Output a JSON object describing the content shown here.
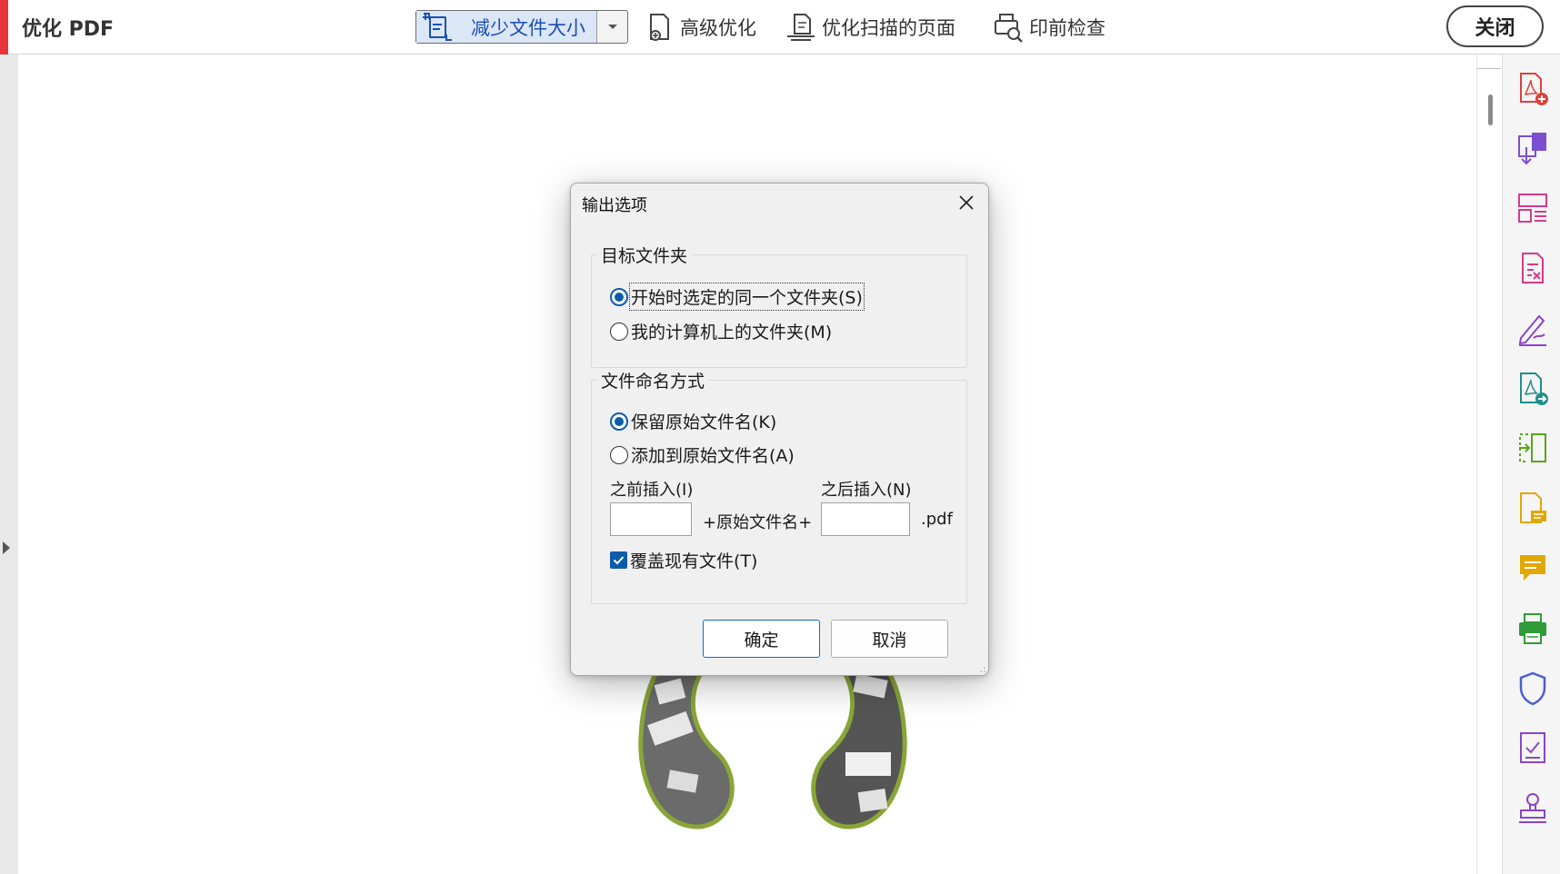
{
  "toolbar": {
    "title": "优化 PDF",
    "dropdown_label": "减少文件大小",
    "tools": [
      "高级优化",
      "优化扫描的页面",
      "印前检查"
    ],
    "close_label": "关闭"
  },
  "dialog": {
    "title": "输出选项",
    "target_folder": {
      "legend": "目标文件夹",
      "option_same": "开始时选定的同一个文件夹(S)",
      "option_computer": "我的计算机上的文件夹(M)"
    },
    "naming": {
      "legend": "文件命名方式",
      "option_keep": "保留原始文件名(K)",
      "option_add": "添加到原始文件名(A)",
      "before_label": "之前插入(I)",
      "after_label": "之后插入(N)",
      "middle_text": "+原始文件名+",
      "extension": ".pdf",
      "before_value": "",
      "after_value": "",
      "overwrite_label": "覆盖现有文件(T)",
      "overwrite_checked": true
    },
    "ok_label": "确定",
    "cancel_label": "取消"
  },
  "right_tools": [
    "create-pdf-icon",
    "export-pdf-icon",
    "organize-pages-icon",
    "edit-pdf-icon",
    "fill-sign-icon",
    "send-for-review-icon",
    "compare-files-icon",
    "comment-file-icon",
    "comment-icon",
    "print-production-icon",
    "protect-icon",
    "prepare-form-icon",
    "stamp-icon"
  ],
  "colors": {
    "accent_red": "#e5343a",
    "selection_blue": "#1c4fb3",
    "radio_blue": "#0b5cad"
  }
}
